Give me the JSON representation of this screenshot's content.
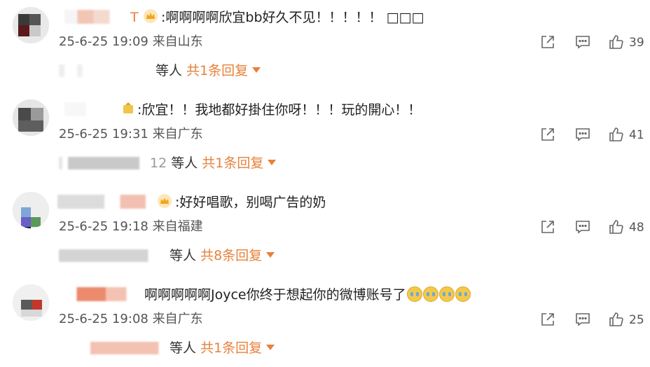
{
  "comments": [
    {
      "name_tail": "T",
      "text": ":啊啊啊啊欣宜bb好久不见！！！！！ ",
      "text_tail": "□□□",
      "date": "25-6-25 19:09",
      "location": "来自山东",
      "likes": "39",
      "reply_prefix": "等人",
      "reply_link": "共1条回复"
    },
    {
      "name_tail": "",
      "text": ":欣宜！！我地都好掛住你呀！！！玩的開心！！",
      "text_tail": "",
      "date": "25-6-25 19:31",
      "location": "来自广东",
      "likes": "41",
      "reply_prefix": "等人",
      "reply_link": "共1条回复",
      "reply_partial": "12"
    },
    {
      "name_tail": "",
      "text": ":好好唱歌，别喝广告的奶",
      "text_tail": "",
      "date": "25-6-25 19:18",
      "location": "来自福建",
      "likes": "48",
      "reply_prefix": "等人",
      "reply_link": "共8条回复"
    },
    {
      "name_tail": "",
      "text": "啊啊啊啊啊Joyce你终于想起你的微博账号了",
      "text_tail": "",
      "date": "25-6-25 19:08",
      "location": "来自广东",
      "likes": "25",
      "reply_prefix": "等人",
      "reply_link": "共1条回复"
    }
  ],
  "icons": {
    "share": "share-icon",
    "comment": "comment-icon",
    "like": "thumbs-up-icon",
    "badge": "crown-badge-icon",
    "emoji": "crying-emoji-icon"
  },
  "colors": {
    "accent": "#e8803a",
    "text": "#1f1f1f",
    "meta": "#555555"
  }
}
